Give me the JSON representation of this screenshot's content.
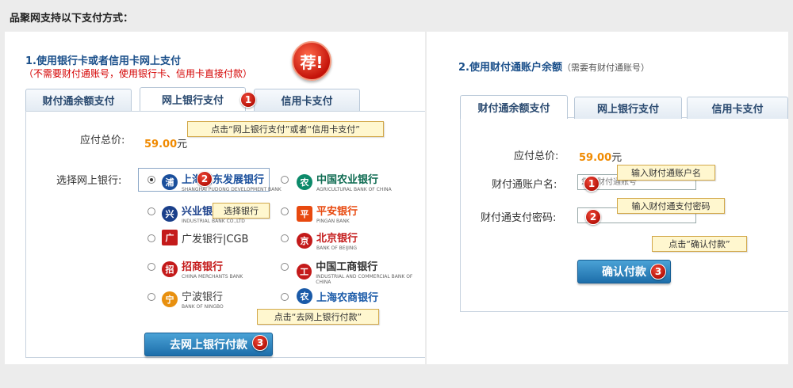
{
  "page_title": "品聚网支持以下支付方式：",
  "left": {
    "section_title": "1.使用银行卡或者信用卡网上支付",
    "section_subtitle": "（不需要财付通账号，使用银行卡、信用卡直接付款）",
    "badge": "荐!",
    "tabs": [
      {
        "label": "财付通余额支付"
      },
      {
        "label": "网上银行支付"
      },
      {
        "label": "信用卡支付"
      }
    ],
    "callout_1": "点击“网上银行支付”或者“信用卡支付”",
    "amount_label": "应付总价:",
    "amount_value": "59.00",
    "amount_unit": "元",
    "select_bank_label": "选择网上银行:",
    "banks": [
      {
        "name": "上海浦东发展银行",
        "sub": "SHANGHAI PUDONG DEVELOPMENT BANK",
        "color": "#1a4f9c",
        "glyph": "浦"
      },
      {
        "name": "中国农业银行",
        "sub": "AGRICULTURAL BANK OF CHINA",
        "color": "#0c8a6a",
        "glyph": "农"
      },
      {
        "name": "兴业银行",
        "sub": "INDUSTRIAL BANK CO.,LTD",
        "color": "#1a3f8a",
        "glyph": "兴"
      },
      {
        "name": "平安银行",
        "sub": "PINGAN BANK",
        "color": "#e8490f",
        "glyph": "平"
      },
      {
        "name": "广发银行|CGB",
        "sub": "",
        "color": "#c41a1a",
        "glyph": "广"
      },
      {
        "name": "北京银行",
        "sub": "BANK OF BEIJING",
        "color": "#c41a1a",
        "glyph": "京"
      },
      {
        "name": "招商银行",
        "sub": "CHINA MERCHANTS BANK",
        "color": "#c41a1a",
        "glyph": "招"
      },
      {
        "name": "中国工商银行",
        "sub": "INDUSTRIAL AND COMMERCIAL BANK OF CHINA",
        "color": "#c41a1a",
        "glyph": "工"
      },
      {
        "name": "宁波银行",
        "sub": "BANK OF NINGBO",
        "color": "#e8900f",
        "glyph": "宁"
      },
      {
        "name": "上海农商银行",
        "sub": "",
        "color": "#1a5aa8",
        "glyph": "农"
      }
    ],
    "callout_2": "选择银行",
    "callout_3": "点击“去网上银行付款”",
    "pay_button": "去网上银行付款",
    "step1": "1",
    "step2": "2",
    "step3": "3"
  },
  "right": {
    "section_title": "2.使用财付通账户余额",
    "section_note": "（需要有财付通账号）",
    "tabs": [
      {
        "label": "财付通余额支付"
      },
      {
        "label": "网上银行支付"
      },
      {
        "label": "信用卡支付"
      }
    ],
    "amount_label": "应付总价:",
    "amount_value": "59.00",
    "amount_unit": "元",
    "account_label": "财付通账户名:",
    "account_placeholder": "您的财付通账号",
    "password_label": "财付通支付密码:",
    "callout_1": "输入财付通账户名",
    "callout_2": "输入财付通支付密码",
    "callout_3": "点击“确认付款”",
    "confirm_button": "确认付款",
    "step1": "1",
    "step2": "2",
    "step3": "3"
  }
}
